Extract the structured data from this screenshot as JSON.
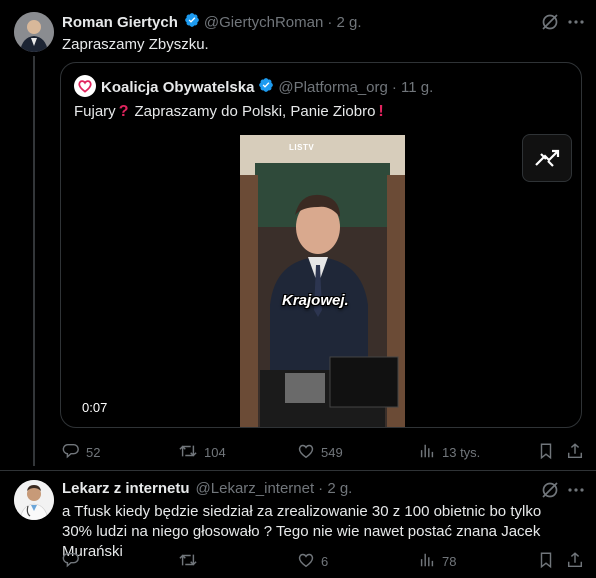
{
  "tweet1": {
    "name": "Roman Giertych",
    "handle": "@GiertychRoman",
    "time": "· 2 g.",
    "text": "Zapraszamy Zbyszku.",
    "quote": {
      "name": "Koalicja Obywatelska",
      "handle": "@Platforma_org",
      "time": "· 11 g.",
      "text_before": "Fujary",
      "text_middle": "Zapraszamy do Polski, Panie Ziobro",
      "video_logo": "LISTV",
      "video_caption": "Krajowej.",
      "video_time": "0:07"
    },
    "actions": {
      "replies": "52",
      "reposts": "104",
      "likes": "549",
      "views": "13 tys."
    }
  },
  "tweet2": {
    "name": "Lekarz z internetu",
    "handle": "@Lekarz_internet",
    "time": "· 2 g.",
    "text": "a Tfusk kiedy będzie siedział za zrealizowanie 30 z 100 obietnic bo tylko 30% ludzi na niego głosowało ? Tego nie wie nawet postać znana Jacek Murański",
    "actions": {
      "replies": "",
      "reposts": "",
      "likes": "6",
      "views": "78"
    }
  },
  "icons": [
    "grok-icon",
    "more-icon",
    "verified-icon",
    "reply-icon",
    "repost-icon",
    "like-icon",
    "views-icon",
    "bookmark-icon",
    "share-icon",
    "heart-logo-icon",
    "exclamation-icon",
    "question-icon",
    "fullscreen-icon"
  ],
  "colors": {
    "background": "#000000",
    "text": "#e7e9ea",
    "muted": "#71767b",
    "verified": "#1d9bf0",
    "emoji_red": "#e0245e"
  }
}
